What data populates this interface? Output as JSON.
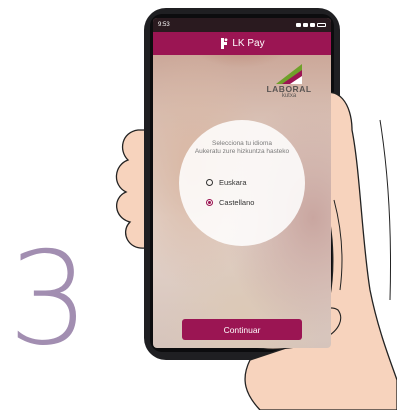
{
  "illustration": {
    "step_number": "3",
    "step_color": "#a28eb1",
    "hand_color": "#f7d3bd"
  },
  "status_bar": {
    "time": "9:53",
    "icons": [
      "notification-icon",
      "wifi-icon",
      "signal-icon",
      "battery-icon"
    ]
  },
  "app_bar": {
    "icon": "lk-pay-icon",
    "title": "LK Pay",
    "color": "#9b1553"
  },
  "brand": {
    "name": "LABORAL",
    "sub": "kutxa"
  },
  "language_prompt": {
    "line1": "Selecciona tu idioma",
    "line2": "Aukeratu zure hizkuntza hasteko"
  },
  "language_options": [
    {
      "label": "Euskara",
      "selected": false
    },
    {
      "label": "Castellano",
      "selected": true
    }
  ],
  "continue_button": {
    "label": "Continuar"
  }
}
